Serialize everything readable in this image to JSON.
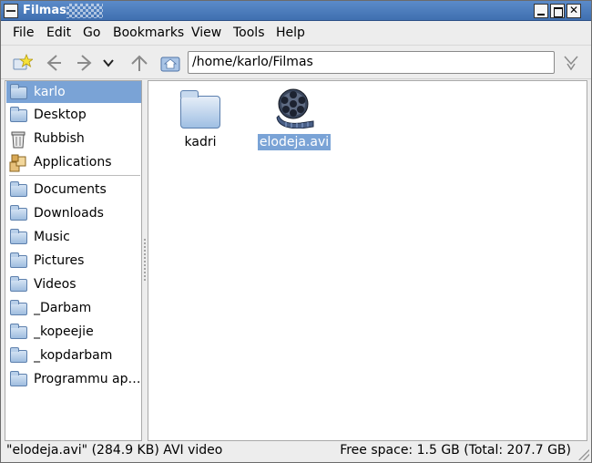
{
  "window": {
    "title": "Filmas"
  },
  "menubar": {
    "items": [
      {
        "label": "File"
      },
      {
        "label": "Edit"
      },
      {
        "label": "Go"
      },
      {
        "label": "Bookmarks"
      },
      {
        "label": "View"
      },
      {
        "label": "Tools"
      },
      {
        "label": "Help"
      }
    ]
  },
  "toolbar": {
    "location": "/home/karlo/Filmas",
    "icons": [
      "new-tab-star-icon",
      "back-icon",
      "forward-icon",
      "history-dropdown-icon",
      "up-icon",
      "home-icon",
      "filter-icon"
    ]
  },
  "sidebar": {
    "items": [
      {
        "label": "karlo",
        "icon": "home-folder-icon",
        "selected": true
      },
      {
        "label": "Desktop",
        "icon": "folder-icon"
      },
      {
        "label": "Rubbish",
        "icon": "trash-icon"
      },
      {
        "label": "Applications",
        "icon": "applications-icon"
      },
      {
        "label": "Documents",
        "icon": "folder-icon"
      },
      {
        "label": "Downloads",
        "icon": "folder-icon"
      },
      {
        "label": "Music",
        "icon": "folder-icon"
      },
      {
        "label": "Pictures",
        "icon": "folder-icon"
      },
      {
        "label": "Videos",
        "icon": "folder-icon"
      },
      {
        "label": "_Darbam",
        "icon": "folder-icon"
      },
      {
        "label": "_kopeejie",
        "icon": "folder-icon"
      },
      {
        "label": "_kopdarbam",
        "icon": "folder-icon"
      },
      {
        "label": "Programmu ap…",
        "icon": "folder-icon"
      }
    ]
  },
  "main": {
    "files": [
      {
        "name": "kadri",
        "icon": "folder-icon",
        "selected": false
      },
      {
        "name": "elodeja.avi",
        "icon": "film-reel-icon",
        "selected": true
      }
    ]
  },
  "status": {
    "left": "\"elodeja.avi\" (284.9 KB) AVI video",
    "right": "Free space: 1.5 GB (Total: 207.7 GB)"
  },
  "colors": {
    "selection": "#7aa3d6",
    "titlebar": "#4a7bbd"
  }
}
